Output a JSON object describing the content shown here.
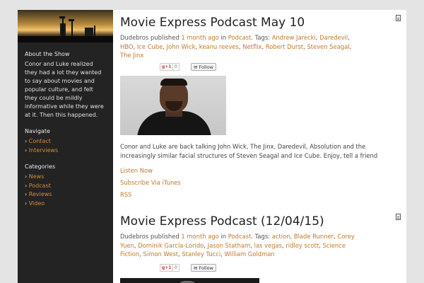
{
  "sidebar": {
    "about_title": "About the Show",
    "about_text": "Conor and Luke realized they had a lot they wanted to say about movies and popular culture, and felt they could be mildly informative while they were at it. Then this happened.",
    "navigate_title": "Navigate",
    "navigate": [
      "Contact",
      "Interviews"
    ],
    "categories_title": "Categories",
    "categories": [
      "News",
      "Podcast",
      "Reviews",
      "Video"
    ],
    "bullet": "›"
  },
  "posts": [
    {
      "title": "Movie Express Podcast May 10",
      "author": "Dudebros",
      "published": "published",
      "time": "1 month ago",
      "in": "in",
      "category": "Podcast",
      "tags_label": ". Tags:",
      "tags": [
        "Andrew Jarecki",
        "Daredevil",
        "HBO",
        "Ice Cube",
        "John Wick",
        "keanu reeves",
        "Netflix",
        "Robert Durst",
        "Steven Seagal",
        "The Jinx"
      ],
      "gplus": "g+1",
      "gcount": "0",
      "follow": "Follow",
      "description": "Conor and Luke are back talking John Wick, The Jinx, Daredevil, Absolution and the increasingly similar facial structures of Steven Seagal and Ice Cube.  Enjoy, tell a friend",
      "links": [
        "Listen Now",
        "Subscribe Via iTunes",
        "RSS"
      ]
    },
    {
      "title": "Movie Express Podcast (12/04/15)",
      "author": "Dudebros",
      "published": "published",
      "time": "1 month ago",
      "in": "in",
      "category": "Podcast",
      "tags_label": ". Tags:",
      "tags": [
        "action",
        "Blade Runner",
        "Corey Yuen",
        "Dominik García-Lorido",
        "Jason Statham",
        "las vegas",
        "ridley scott",
        "Science Fiction",
        "Simon West",
        "Stanley Tucci",
        "William Goldman"
      ],
      "gplus": "g+1",
      "gcount": "0",
      "follow": "Follow"
    }
  ],
  "colors": {
    "link": "#c0782c",
    "sidebar_bg": "#232323",
    "page_bg": "#e4e4e4"
  },
  "icons": {
    "post_format": "document-icon",
    "follow": "envelope-icon"
  }
}
